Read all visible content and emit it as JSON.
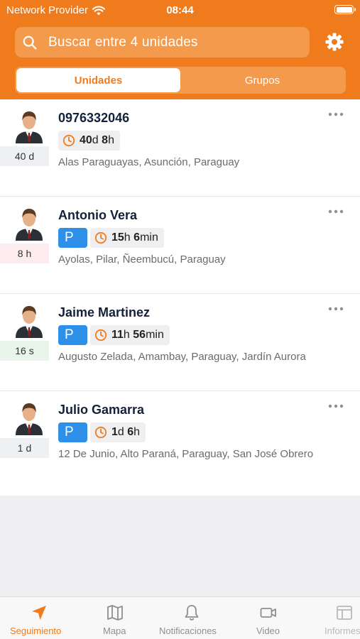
{
  "status_bar": {
    "carrier": "Network Provider",
    "time": "08:44"
  },
  "search": {
    "placeholder": "Buscar entre 4 unidades"
  },
  "segments": {
    "units_label": "Unidades",
    "groups_label": "Grupos",
    "selected": "Unidades"
  },
  "units": [
    {
      "name": "0976332046",
      "age": "40 d",
      "age_color": "#eef0f4",
      "parked": false,
      "duration": {
        "v1": "40",
        "u1": "d",
        "v2": "8",
        "u2": "h"
      },
      "address": "Alas Paraguayas, Asunción, Paraguay"
    },
    {
      "name": "Antonio Vera",
      "age": "8 h",
      "age_color": "#fdecef",
      "parked": true,
      "parking_label": "P",
      "duration": {
        "v1": "15",
        "u1": "h",
        "v2": "6",
        "u2": "min"
      },
      "address": "Ayolas, Pilar, Ñeembucú, Paraguay"
    },
    {
      "name": "Jaime Martinez",
      "age": "16 s",
      "age_color": "#e9f5ea",
      "parked": true,
      "parking_label": "P",
      "duration": {
        "v1": "11",
        "u1": "h",
        "v2": "56",
        "u2": "min"
      },
      "address": "Augusto Zelada, Amambay, Paraguay, Jardín Aurora"
    },
    {
      "name": "Julio Gamarra",
      "age": "1 d",
      "age_color": "#eef0f4",
      "parked": true,
      "parking_label": "P",
      "duration": {
        "v1": "1",
        "u1": "d",
        "v2": "6",
        "u2": "h"
      },
      "address": "12 De Junio, Alto Paraná, Paraguay, San José Obrero"
    }
  ],
  "tabbar": {
    "tracking": "Seguimiento",
    "map": "Mapa",
    "notifications": "Notificaciones",
    "video": "Video",
    "reports": "Informes",
    "active": "Seguimiento"
  },
  "colors": {
    "brand_orange": "#f07b1c",
    "parking_blue": "#2d8fe8",
    "icons": {
      "tracking": "navigation-arrow-icon",
      "map": "map-icon",
      "notifications": "bell-icon",
      "video": "video-camera-icon",
      "reports": "report-table-icon"
    }
  }
}
